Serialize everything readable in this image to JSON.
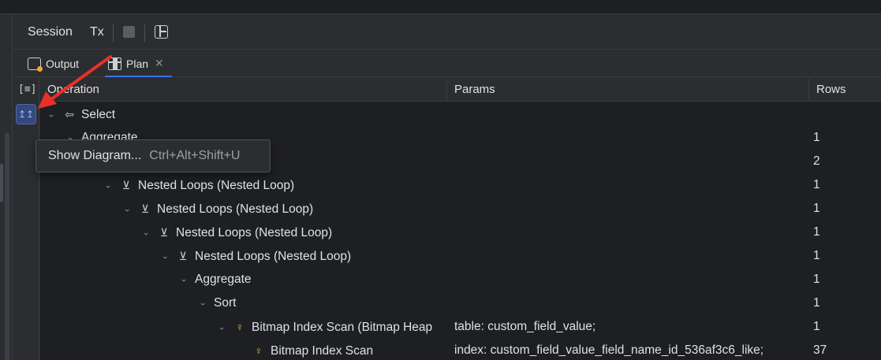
{
  "toolbar": {
    "session_label": "Session",
    "tx_label": "Tx"
  },
  "tabs": [
    {
      "label": "Output"
    },
    {
      "label": "Plan"
    }
  ],
  "tab_close_glyph": "✕",
  "table": {
    "headers": {
      "operation": "Operation",
      "params": "Params",
      "rows": "Rows"
    },
    "rows": [
      {
        "indent": 0,
        "icon": "arrow-left-icon",
        "operation": "Select",
        "params": "",
        "rows": ""
      },
      {
        "indent": 1,
        "icon": "",
        "operation": "Aggregate",
        "params": "",
        "rows": "1"
      },
      {
        "indent": 2,
        "icon": "",
        "operation": "",
        "params": "",
        "rows": "2"
      },
      {
        "indent": 3,
        "icon": "nested-loop-icon",
        "operation": "Nested Loops (Nested Loop)",
        "params": "",
        "rows": "1"
      },
      {
        "indent": 4,
        "icon": "nested-loop-icon",
        "operation": "Nested Loops (Nested Loop)",
        "params": "",
        "rows": "1"
      },
      {
        "indent": 5,
        "icon": "nested-loop-icon",
        "operation": "Nested Loops (Nested Loop)",
        "params": "",
        "rows": "1"
      },
      {
        "indent": 6,
        "icon": "nested-loop-icon",
        "operation": "Nested Loops (Nested Loop)",
        "params": "",
        "rows": "1"
      },
      {
        "indent": 7,
        "icon": "",
        "operation": "Aggregate",
        "params": "",
        "rows": "1"
      },
      {
        "indent": 8,
        "icon": "",
        "operation": "Sort",
        "params": "",
        "rows": "1"
      },
      {
        "indent": 9,
        "icon": "key-icon",
        "operation": "Bitmap Index Scan (Bitmap Heap",
        "params": "table: custom_field_value;",
        "rows": "1"
      },
      {
        "indent": 10,
        "icon": "key-icon",
        "operation": "Bitmap Index Scan",
        "params": "index: custom_field_value_field_name_id_536af3c6_like;",
        "rows": "37",
        "leaf": true
      }
    ]
  },
  "tooltip": {
    "label": "Show Diagram...",
    "shortcut": "Ctrl+Alt+Shift+U"
  },
  "colors": {
    "background": "#1e1f22",
    "panel": "#2b2d30",
    "accent": "#3574f0",
    "annotation_arrow": "#e8302a"
  }
}
